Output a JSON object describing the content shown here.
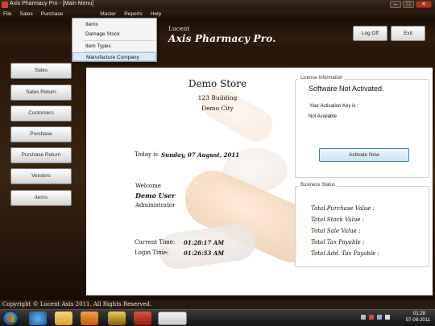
{
  "window": {
    "title": "Axis Pharmacy Pro - [Main Menu]"
  },
  "menubar": [
    "File",
    "Sales",
    "Purchase",
    "Master",
    "Reports",
    "Help"
  ],
  "dropdown": {
    "items": [
      "Items",
      "Damage Stock",
      "Item Types",
      "Manufacture Company"
    ],
    "highlighted": "Manufacture Company"
  },
  "header": {
    "brand_line1": "Lucent",
    "brand_line2": "Axis Pharmacy Pro.",
    "logoff_label": "Log Off",
    "exit_label": "Exit"
  },
  "sidebar": [
    "Sales",
    "Sales Return",
    "Customers",
    "Purchase",
    "Purchase Return",
    "Vendors",
    "Items"
  ],
  "store": {
    "name": "Demo Store",
    "address1": "123 Building",
    "address2": "Demo City"
  },
  "today": {
    "label": "Today is",
    "value": "Sunday, 07 August, 2011"
  },
  "user": {
    "welcome": "Welcome",
    "name": "Demo User",
    "role": "Administrator"
  },
  "times": {
    "current_label": "Current Time:",
    "current_value": "01:28:17 AM",
    "login_label": "Login Time:",
    "login_value": "01:26:53 AM"
  },
  "license": {
    "group_title": "License Information",
    "status": "Software Not Activated.",
    "key_label": "Your Activation Key is :",
    "key_value": "Not Available",
    "activate_label": "Activate Now"
  },
  "business": {
    "group_title": "Business Status",
    "items": [
      "Total Purchase Value :",
      "Total Stock Value :",
      "Total Sale Value :",
      "Total Tax Payable :",
      "Total Add. Tax Payable :"
    ]
  },
  "footer": {
    "copyright": "Copyright © Lucent Axis 2011. All Rights Reserved."
  },
  "taskbar": {
    "time": "01:28",
    "date": "07-08-2011"
  },
  "colors": {
    "brown_dark": "#1a0e06",
    "panel": "#ffffff",
    "activate_border": "#3c7fb1",
    "highlight": "#dbeaf8"
  }
}
